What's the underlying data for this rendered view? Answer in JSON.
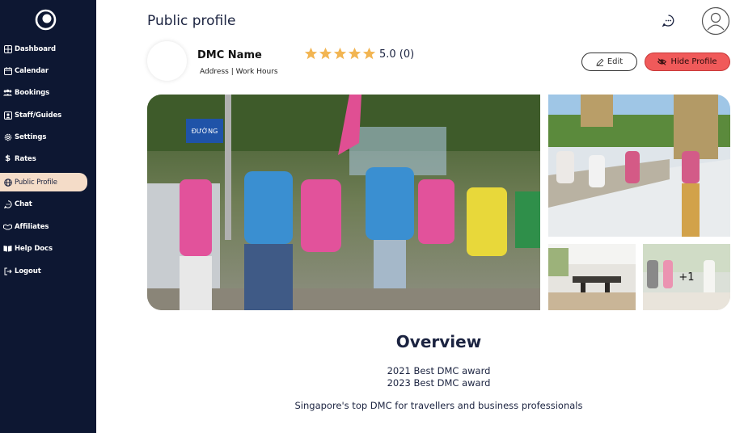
{
  "sidebar": {
    "items": [
      {
        "label": "Dashboard",
        "icon": "grid-icon",
        "active": false
      },
      {
        "label": "Calendar",
        "icon": "calendar-icon",
        "active": false
      },
      {
        "label": "Bookings",
        "icon": "people-icon",
        "active": false
      },
      {
        "label": "Staff/Guides",
        "icon": "id-card-icon",
        "active": false
      },
      {
        "label": "Settings",
        "icon": "gear-icon",
        "active": false
      },
      {
        "label": "Rates",
        "icon": "dollar-icon",
        "active": false
      },
      {
        "label": "Public Profile",
        "icon": "globe-icon",
        "active": true
      },
      {
        "label": "Chat",
        "icon": "chat-icon",
        "active": false
      },
      {
        "label": "Affiliates",
        "icon": "handshake-icon",
        "active": false
      },
      {
        "label": "Help Docs",
        "icon": "book-icon",
        "active": false
      },
      {
        "label": "Logout",
        "icon": "logout-icon",
        "active": false
      }
    ]
  },
  "header": {
    "title": "Public profile"
  },
  "profile": {
    "name": "DMC Name",
    "address_line": "Address |  Work Hours",
    "rating_stars": 5,
    "rating_text": "5.0 (0)",
    "edit_label": "Edit",
    "hide_label": "Hide Profile"
  },
  "gallery": {
    "more_label": "+1"
  },
  "overview": {
    "heading": "Overview",
    "award_1": "2021 Best DMC award",
    "award_2": "2023 Best DMC award",
    "tagline": "Singapore's top DMC for travellers and business professionals"
  },
  "colors": {
    "sidebar_bg": "#0d1732",
    "active_bg": "#f4dcc8",
    "star": "#f2b552",
    "hide_button": "#f05a5a"
  }
}
